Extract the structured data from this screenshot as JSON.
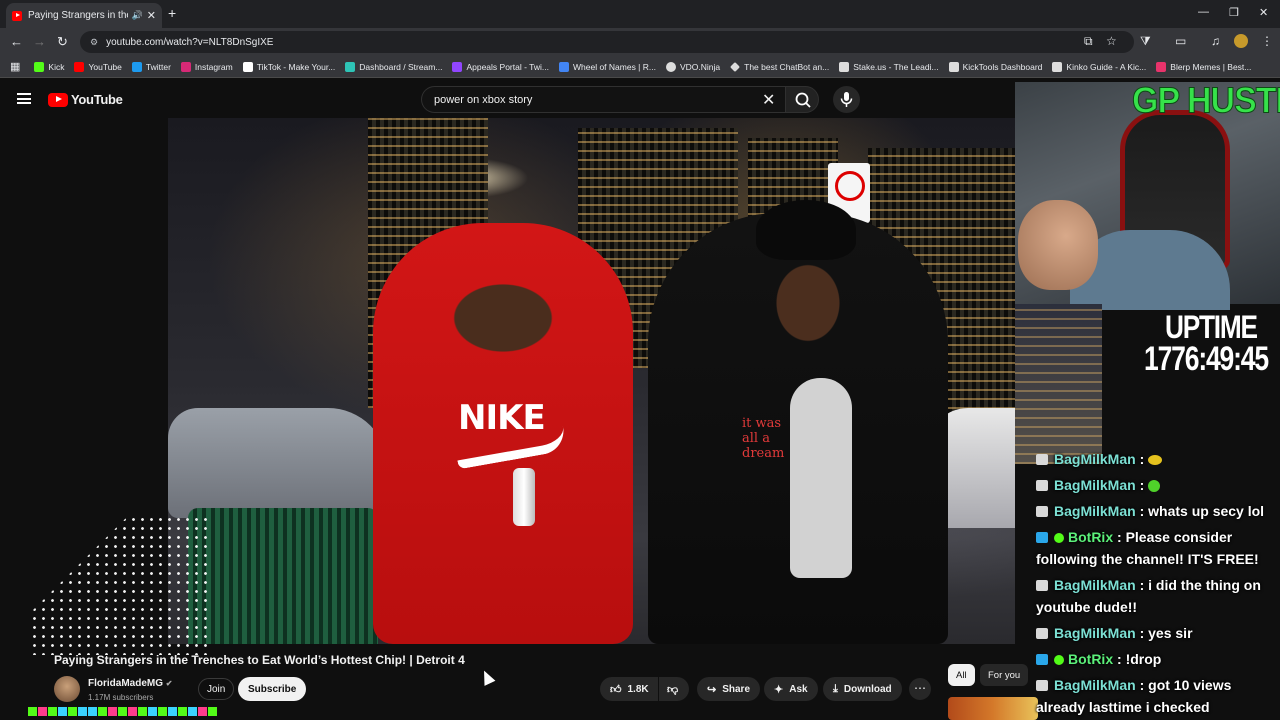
{
  "browser": {
    "tab_title": "Paying Strangers in the Tre",
    "url": "youtube.com/watch?v=NLT8DnSgIXE",
    "bookmarks": [
      {
        "label": "Kick",
        "color": "#53fc18"
      },
      {
        "label": "YouTube",
        "color": "#ff0000"
      },
      {
        "label": "Twitter",
        "color": "#1d9bf0"
      },
      {
        "label": "Instagram",
        "color": "#d62976"
      },
      {
        "label": "TikTok - Make Your...",
        "color": "#ffffff"
      },
      {
        "label": "Dashboard / Stream...",
        "color": "#2ec4b6"
      },
      {
        "label": "Appeals Portal - Twi...",
        "color": "#9146ff"
      },
      {
        "label": "Wheel of Names | R...",
        "color": "#4285f4"
      },
      {
        "label": "VDO.Ninja",
        "color": "#dddddd"
      },
      {
        "label": "The best ChatBot an...",
        "color": "#dddddd"
      },
      {
        "label": "Stake.us - The Leadi...",
        "color": "#dddddd"
      },
      {
        "label": "KickTools Dashboard",
        "color": "#dddddd"
      },
      {
        "label": "Kinko Guide - A Kic...",
        "color": "#dddddd"
      },
      {
        "label": "Blerp Memes | Best...",
        "color": "#e8336b"
      }
    ]
  },
  "youtube": {
    "logo": "YouTube",
    "search_query": "power on xbox story",
    "video": {
      "title": "Paying Strangers in the Trenches to Eat World’s Hottest Chip! | Detroit 4",
      "channel": "FloridaMadeMG",
      "subscribers": "1.17M subscribers",
      "shirt_text": "it was all a dream",
      "shirt_logo": "NIKE"
    },
    "actions": {
      "join": "Join",
      "subscribe": "Subscribe",
      "likes": "1.8K",
      "share": "Share",
      "ask": "Ask",
      "download": "Download"
    },
    "chips": {
      "all": "All",
      "for_you": "For you"
    }
  },
  "overlay": {
    "banner": "GP HUSTLA",
    "uptime_label": "UPTIME",
    "uptime_value": "1776:49:45",
    "chat": [
      {
        "user": "BagMilkMan",
        "text": "",
        "emote": "yellow"
      },
      {
        "user": "BagMilkMan",
        "text": "",
        "emote": "green"
      },
      {
        "user": "BagMilkMan",
        "text": "whats up secy lol"
      },
      {
        "user": "BotRix",
        "bot": true,
        "text": "Please consider following the channel! IT'S FREE!"
      },
      {
        "user": "BagMilkMan",
        "text": "i did the thing on youtube dude!!"
      },
      {
        "user": "BagMilkMan",
        "text": "yes sir"
      },
      {
        "user": "BotRix",
        "bot": true,
        "text": "!drop"
      },
      {
        "user": "BagMilkMan",
        "text": "got 10 views already lasttime i checked"
      }
    ]
  },
  "colors": {
    "accent_red": "#ff0000",
    "overlay_green": "#36e24a",
    "chat_name": "#7ce0d4"
  }
}
